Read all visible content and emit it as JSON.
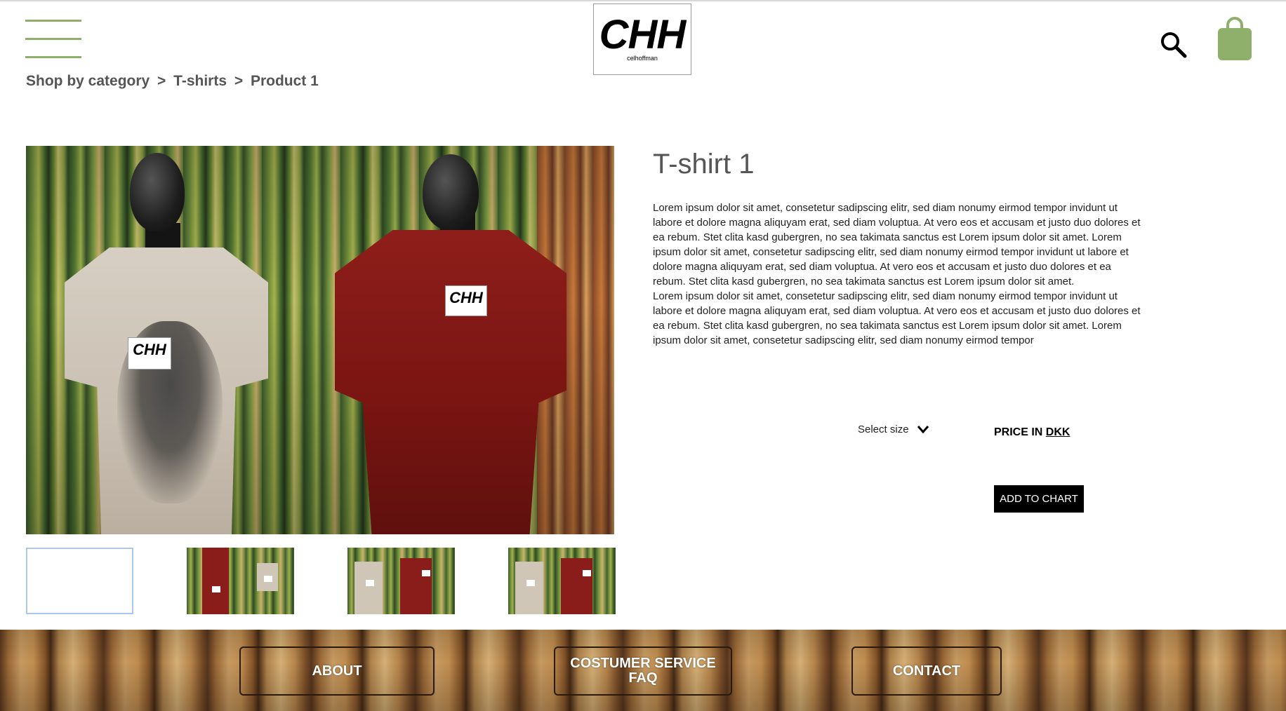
{
  "header": {
    "logo_mark": "CHH",
    "logo_sub": "celhoffman",
    "icons": {
      "menu": "hamburger-menu-icon",
      "search": "search-icon",
      "cart": "shopping-bag-icon"
    },
    "accent_color": "#8fb06b"
  },
  "breadcrumb": {
    "items": [
      "Shop by category",
      "T-shirts",
      "Product 1"
    ],
    "separator": ">"
  },
  "gallery": {
    "labels": [
      "CHH",
      "CHH"
    ],
    "thumbnails_count": 4,
    "selected_index": 0,
    "selected_border_color": "#a9c7ef"
  },
  "product": {
    "title": "T-shirt 1",
    "description": [
      "Lorem ipsum dolor sit amet, consetetur sadipscing elitr, sed diam nonumy eirmod tempor invidunt ut labore et dolore magna aliquyam erat, sed diam voluptua. At vero eos et accusam et justo duo dolores et ea rebum. Stet clita kasd gubergren, no sea takimata sanctus est Lorem ipsum dolor sit amet. Lorem ipsum dolor sit amet, consetetur sadipscing elitr, sed diam nonumy eirmod tempor invidunt ut labore et dolore magna aliquyam erat, sed diam voluptua. At vero eos et accusam et justo duo dolores et ea rebum. Stet clita kasd gubergren, no sea takimata sanctus est Lorem ipsum dolor sit amet.",
      "Lorem ipsum dolor sit amet, consetetur sadipscing elitr, sed diam nonumy eirmod tempor invidunt ut labore et dolore magna aliquyam erat, sed diam voluptua. At vero eos et accusam et justo duo dolores et ea rebum. Stet clita kasd gubergren, no sea takimata sanctus est Lorem ipsum dolor sit amet. Lorem ipsum dolor sit amet, consetetur sadipscing elitr, sed diam nonumy eirmod tempor"
    ],
    "size_select_label": "Select size",
    "price_prefix": "PRICE IN",
    "currency": "DKK",
    "add_button": "ADD TO CHART"
  },
  "footer": {
    "about": "ABOUT",
    "customer_service_line1": "COSTUMER SERVICE",
    "customer_service_line2": "FAQ",
    "contact": "CONTACT"
  }
}
